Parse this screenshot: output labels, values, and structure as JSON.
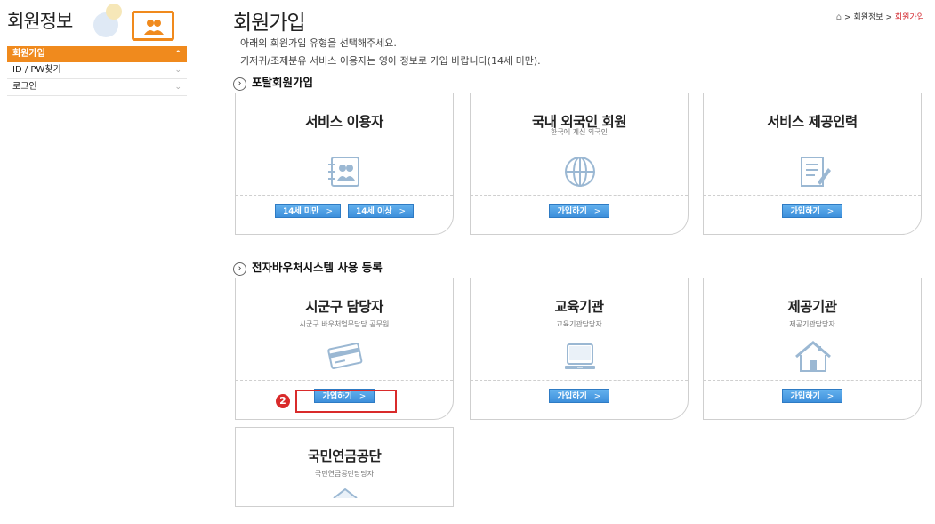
{
  "sidebar": {
    "title": "회원정보",
    "items": [
      {
        "label": "회원가입",
        "chevron": "^",
        "active": true
      },
      {
        "label": "ID / PW찾기",
        "chevron": "⌄"
      },
      {
        "label": "로그인",
        "chevron": "⌄"
      }
    ]
  },
  "header": {
    "title": "회원가입",
    "breadcrumb": {
      "home_icon": "home-icon",
      "sep": ">",
      "item1": "회원정보",
      "item2": "회원가입"
    }
  },
  "intro": [
    "아래의 회원가입 유형을 선택해주세요.",
    "기저귀/조제분유 서비스 이용자는 영아 정보로 가입 바랍니다(14세 미만)."
  ],
  "sections": {
    "portal": {
      "title": "포탈회원가입",
      "cards": [
        {
          "title": "서비스 이용자",
          "subtitle": "",
          "icon": "contact-book-icon",
          "buttons": [
            "14세 미만",
            "14세 이상"
          ]
        },
        {
          "title": "국내 외국인 회원",
          "subtitle": "한국에 계신 외국인",
          "icon": "globe-icon",
          "buttons": [
            "가입하기"
          ]
        },
        {
          "title": "서비스 제공인력",
          "subtitle": "",
          "icon": "document-edit-icon",
          "buttons": [
            "가입하기"
          ]
        }
      ]
    },
    "voucher": {
      "title": "전자바우처시스템 사용 등록",
      "cards": [
        {
          "title": "시군구 담당자",
          "subtitle": "시군구 바우처업무담당 공무원",
          "icon": "card-icon",
          "buttons": [
            "가입하기"
          ]
        },
        {
          "title": "교육기관",
          "subtitle": "교육기관담당자",
          "icon": "monitor-icon",
          "buttons": [
            "가입하기"
          ]
        },
        {
          "title": "제공기관",
          "subtitle": "제공기관담당자",
          "icon": "house-icon",
          "buttons": [
            "가입하기"
          ]
        },
        {
          "title": "국민연금공단",
          "subtitle": "국민연금공단담당자",
          "icon": "house-icon",
          "buttons": []
        }
      ]
    }
  },
  "annotation": {
    "marker": "2"
  },
  "colors": {
    "accent": "#f08a1d",
    "button": "#3d8fdb",
    "highlight": "#d92b2b"
  }
}
